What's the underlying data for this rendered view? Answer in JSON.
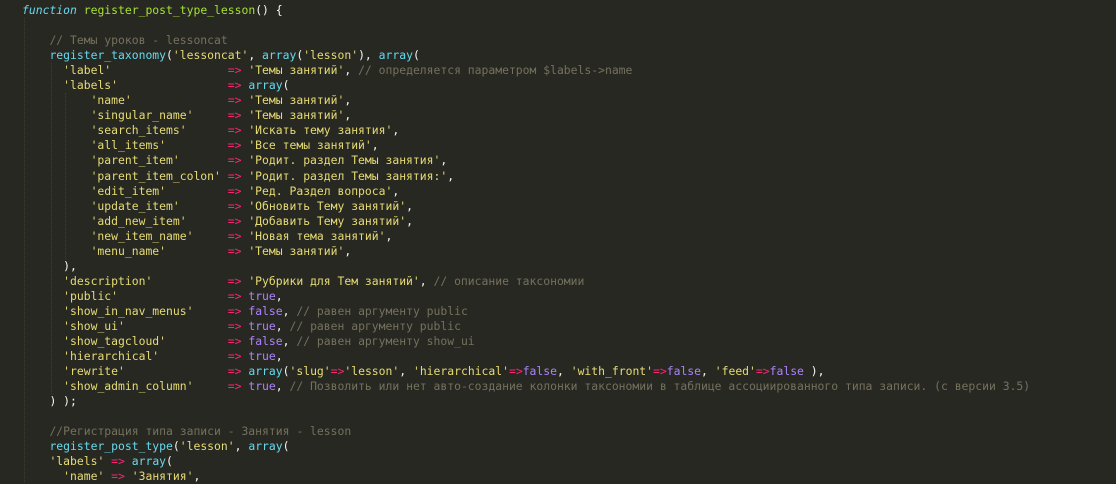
{
  "editor": {
    "colors": {
      "background": "#272822",
      "storage": "#66D9EF",
      "entity": "#A6E22E",
      "plain": "#F8F8F2",
      "string": "#E6DB74",
      "operator": "#F92672",
      "constant": "#AE81FF",
      "support": "#66D9EF",
      "comment": "#75715E"
    },
    "lines": [
      [
        [
          "function",
          "storage"
        ],
        [
          " ",
          "plain"
        ],
        [
          "register_post_type_lesson",
          "entity"
        ],
        [
          "() {",
          "plain"
        ]
      ],
      [],
      [
        [
          "    ",
          "plain"
        ],
        [
          "// Темы уроков - lessoncat",
          "comment"
        ]
      ],
      [
        [
          "    ",
          "plain"
        ],
        [
          "register_taxonomy",
          "support"
        ],
        [
          "(",
          "plain"
        ],
        [
          "'lessoncat'",
          "string"
        ],
        [
          ", ",
          "plain"
        ],
        [
          "array",
          "support"
        ],
        [
          "(",
          "plain"
        ],
        [
          "'lesson'",
          "string"
        ],
        [
          "), ",
          "plain"
        ],
        [
          "array",
          "support"
        ],
        [
          "(",
          "plain"
        ]
      ],
      [
        [
          "      ",
          "plain"
        ],
        [
          "'label'",
          "string"
        ],
        [
          "                 ",
          "plain"
        ],
        [
          "=>",
          "op"
        ],
        [
          " ",
          "plain"
        ],
        [
          "'Темы занятий'",
          "string"
        ],
        [
          ", ",
          "plain"
        ],
        [
          "// определяется параметром $labels->name",
          "comment"
        ]
      ],
      [
        [
          "      ",
          "plain"
        ],
        [
          "'labels'",
          "string"
        ],
        [
          "                ",
          "plain"
        ],
        [
          "=>",
          "op"
        ],
        [
          " ",
          "plain"
        ],
        [
          "array",
          "support"
        ],
        [
          "(",
          "plain"
        ]
      ],
      [
        [
          "          ",
          "plain"
        ],
        [
          "'name'",
          "string"
        ],
        [
          "              ",
          "plain"
        ],
        [
          "=>",
          "op"
        ],
        [
          " ",
          "plain"
        ],
        [
          "'Темы занятий'",
          "string"
        ],
        [
          ",",
          "plain"
        ]
      ],
      [
        [
          "          ",
          "plain"
        ],
        [
          "'singular_name'",
          "string"
        ],
        [
          "     ",
          "plain"
        ],
        [
          "=>",
          "op"
        ],
        [
          " ",
          "plain"
        ],
        [
          "'Темы занятий'",
          "string"
        ],
        [
          ",",
          "plain"
        ]
      ],
      [
        [
          "          ",
          "plain"
        ],
        [
          "'search_items'",
          "string"
        ],
        [
          "      ",
          "plain"
        ],
        [
          "=>",
          "op"
        ],
        [
          " ",
          "plain"
        ],
        [
          "'Искать тему занятия'",
          "string"
        ],
        [
          ",",
          "plain"
        ]
      ],
      [
        [
          "          ",
          "plain"
        ],
        [
          "'all_items'",
          "string"
        ],
        [
          "         ",
          "plain"
        ],
        [
          "=>",
          "op"
        ],
        [
          " ",
          "plain"
        ],
        [
          "'Все темы занятий'",
          "string"
        ],
        [
          ",",
          "plain"
        ]
      ],
      [
        [
          "          ",
          "plain"
        ],
        [
          "'parent_item'",
          "string"
        ],
        [
          "       ",
          "plain"
        ],
        [
          "=>",
          "op"
        ],
        [
          " ",
          "plain"
        ],
        [
          "'Родит. раздел Темы занятия'",
          "string"
        ],
        [
          ",",
          "plain"
        ]
      ],
      [
        [
          "          ",
          "plain"
        ],
        [
          "'parent_item_colon'",
          "string"
        ],
        [
          " ",
          "plain"
        ],
        [
          "=>",
          "op"
        ],
        [
          " ",
          "plain"
        ],
        [
          "'Родит. раздел Темы занятия:'",
          "string"
        ],
        [
          ",",
          "plain"
        ]
      ],
      [
        [
          "          ",
          "plain"
        ],
        [
          "'edit_item'",
          "string"
        ],
        [
          "         ",
          "plain"
        ],
        [
          "=>",
          "op"
        ],
        [
          " ",
          "plain"
        ],
        [
          "'Ред. Раздел вопроса'",
          "string"
        ],
        [
          ",",
          "plain"
        ]
      ],
      [
        [
          "          ",
          "plain"
        ],
        [
          "'update_item'",
          "string"
        ],
        [
          "       ",
          "plain"
        ],
        [
          "=>",
          "op"
        ],
        [
          " ",
          "plain"
        ],
        [
          "'Обновить Тему занятий'",
          "string"
        ],
        [
          ",",
          "plain"
        ]
      ],
      [
        [
          "          ",
          "plain"
        ],
        [
          "'add_new_item'",
          "string"
        ],
        [
          "      ",
          "plain"
        ],
        [
          "=>",
          "op"
        ],
        [
          " ",
          "plain"
        ],
        [
          "'Добавить Тему занятий'",
          "string"
        ],
        [
          ",",
          "plain"
        ]
      ],
      [
        [
          "          ",
          "plain"
        ],
        [
          "'new_item_name'",
          "string"
        ],
        [
          "     ",
          "plain"
        ],
        [
          "=>",
          "op"
        ],
        [
          " ",
          "plain"
        ],
        [
          "'Новая тема занятий'",
          "string"
        ],
        [
          ",",
          "plain"
        ]
      ],
      [
        [
          "          ",
          "plain"
        ],
        [
          "'menu_name'",
          "string"
        ],
        [
          "         ",
          "plain"
        ],
        [
          "=>",
          "op"
        ],
        [
          " ",
          "plain"
        ],
        [
          "'Темы занятий'",
          "string"
        ],
        [
          ",",
          "plain"
        ]
      ],
      [
        [
          "      ",
          "plain"
        ],
        [
          "),",
          "plain"
        ]
      ],
      [
        [
          "      ",
          "plain"
        ],
        [
          "'description'",
          "string"
        ],
        [
          "           ",
          "plain"
        ],
        [
          "=>",
          "op"
        ],
        [
          " ",
          "plain"
        ],
        [
          "'Рубрики для Тем занятий'",
          "string"
        ],
        [
          ", ",
          "plain"
        ],
        [
          "// описание таксономии",
          "comment"
        ]
      ],
      [
        [
          "      ",
          "plain"
        ],
        [
          "'public'",
          "string"
        ],
        [
          "                ",
          "plain"
        ],
        [
          "=>",
          "op"
        ],
        [
          " ",
          "plain"
        ],
        [
          "true",
          "const"
        ],
        [
          ",",
          "plain"
        ]
      ],
      [
        [
          "      ",
          "plain"
        ],
        [
          "'show_in_nav_menus'",
          "string"
        ],
        [
          "     ",
          "plain"
        ],
        [
          "=>",
          "op"
        ],
        [
          " ",
          "plain"
        ],
        [
          "false",
          "const"
        ],
        [
          ", ",
          "plain"
        ],
        [
          "// равен аргументу public",
          "comment"
        ]
      ],
      [
        [
          "      ",
          "plain"
        ],
        [
          "'show_ui'",
          "string"
        ],
        [
          "               ",
          "plain"
        ],
        [
          "=>",
          "op"
        ],
        [
          " ",
          "plain"
        ],
        [
          "true",
          "const"
        ],
        [
          ", ",
          "plain"
        ],
        [
          "// равен аргументу public",
          "comment"
        ]
      ],
      [
        [
          "      ",
          "plain"
        ],
        [
          "'show_tagcloud'",
          "string"
        ],
        [
          "         ",
          "plain"
        ],
        [
          "=>",
          "op"
        ],
        [
          " ",
          "plain"
        ],
        [
          "false",
          "const"
        ],
        [
          ", ",
          "plain"
        ],
        [
          "// равен аргументу show_ui",
          "comment"
        ]
      ],
      [
        [
          "      ",
          "plain"
        ],
        [
          "'hierarchical'",
          "string"
        ],
        [
          "          ",
          "plain"
        ],
        [
          "=>",
          "op"
        ],
        [
          " ",
          "plain"
        ],
        [
          "true",
          "const"
        ],
        [
          ",",
          "plain"
        ]
      ],
      [
        [
          "      ",
          "plain"
        ],
        [
          "'rewrite'",
          "string"
        ],
        [
          "               ",
          "plain"
        ],
        [
          "=>",
          "op"
        ],
        [
          " ",
          "plain"
        ],
        [
          "array",
          "support"
        ],
        [
          "(",
          "plain"
        ],
        [
          "'slug'",
          "string"
        ],
        [
          "=>",
          "op"
        ],
        [
          "'lesson'",
          "string"
        ],
        [
          ", ",
          "plain"
        ],
        [
          "'hierarchical'",
          "string"
        ],
        [
          "=>",
          "op"
        ],
        [
          "false",
          "const"
        ],
        [
          ", ",
          "plain"
        ],
        [
          "'with_front'",
          "string"
        ],
        [
          "=>",
          "op"
        ],
        [
          "false",
          "const"
        ],
        [
          ", ",
          "plain"
        ],
        [
          "'feed'",
          "string"
        ],
        [
          "=>",
          "op"
        ],
        [
          "false",
          "const"
        ],
        [
          " ),",
          "plain"
        ]
      ],
      [
        [
          "      ",
          "plain"
        ],
        [
          "'show_admin_column'",
          "string"
        ],
        [
          "     ",
          "plain"
        ],
        [
          "=>",
          "op"
        ],
        [
          " ",
          "plain"
        ],
        [
          "true",
          "const"
        ],
        [
          ", ",
          "plain"
        ],
        [
          "// Позволить или нет авто-создание колонки таксономии в таблице ассоциированного типа записи. (с версии 3.5)",
          "comment"
        ]
      ],
      [
        [
          "    ",
          "plain"
        ],
        [
          ") );",
          "plain"
        ]
      ],
      [],
      [
        [
          "    ",
          "plain"
        ],
        [
          "//Регистрация типа записи - Занятия - lesson",
          "comment"
        ]
      ],
      [
        [
          "    ",
          "plain"
        ],
        [
          "register_post_type",
          "support"
        ],
        [
          "(",
          "plain"
        ],
        [
          "'lesson'",
          "string"
        ],
        [
          ", ",
          "plain"
        ],
        [
          "array",
          "support"
        ],
        [
          "(",
          "plain"
        ]
      ],
      [
        [
          "    ",
          "plain"
        ],
        [
          "'labels'",
          "string"
        ],
        [
          " ",
          "plain"
        ],
        [
          "=>",
          "op"
        ],
        [
          " ",
          "plain"
        ],
        [
          "array",
          "support"
        ],
        [
          "(",
          "plain"
        ]
      ],
      [
        [
          "      ",
          "plain"
        ],
        [
          "'name'",
          "string"
        ],
        [
          " ",
          "plain"
        ],
        [
          "=>",
          "op"
        ],
        [
          " ",
          "plain"
        ],
        [
          "'Занятия'",
          "string"
        ],
        [
          ",",
          "plain"
        ]
      ]
    ]
  }
}
